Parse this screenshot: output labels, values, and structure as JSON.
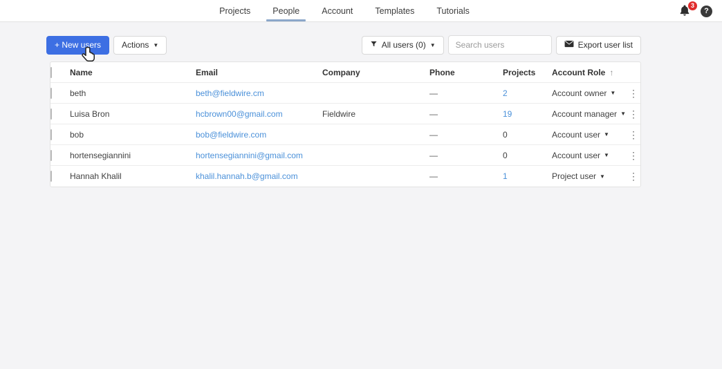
{
  "nav": {
    "tabs": [
      {
        "label": "Projects",
        "active": false
      },
      {
        "label": "People",
        "active": true
      },
      {
        "label": "Account",
        "active": false
      },
      {
        "label": "Templates",
        "active": false
      },
      {
        "label": "Tutorials",
        "active": false
      }
    ],
    "notification_count": "3",
    "help_label": "?"
  },
  "toolbar": {
    "new_users_label": "+ New users",
    "actions_label": "Actions",
    "filter_label": "All users (0)",
    "search_placeholder": "Search users",
    "export_label": "Export user list"
  },
  "table": {
    "headers": {
      "name": "Name",
      "email": "Email",
      "company": "Company",
      "phone": "Phone",
      "projects": "Projects",
      "role": "Account Role"
    },
    "sort_icon": "↑",
    "rows": [
      {
        "name": "beth",
        "email": "beth@fieldwire.cm",
        "company": "",
        "phone": "—",
        "projects": "2",
        "projects_link": true,
        "role": "Account owner"
      },
      {
        "name": "Luisa Bron",
        "email": "hcbrown00@gmail.com",
        "company": "Fieldwire",
        "phone": "—",
        "projects": "19",
        "projects_link": true,
        "role": "Account manager"
      },
      {
        "name": "bob",
        "email": "bob@fieldwire.com",
        "company": "",
        "phone": "—",
        "projects": "0",
        "projects_link": false,
        "role": "Account user"
      },
      {
        "name": "hortensegiannini",
        "email": "hortensegiannini@gmail.com",
        "company": "",
        "phone": "—",
        "projects": "0",
        "projects_link": false,
        "role": "Account user"
      },
      {
        "name": "Hannah Khalil",
        "email": "khalil.hannah.b@gmail.com",
        "company": "",
        "phone": "—",
        "projects": "1",
        "projects_link": true,
        "role": "Project user"
      }
    ]
  },
  "colors": {
    "primary_button": "#3d6fe3",
    "link": "#4a90d9",
    "active_tab_underline": "#8ba7ca",
    "notification_badge": "#e02b2b"
  }
}
